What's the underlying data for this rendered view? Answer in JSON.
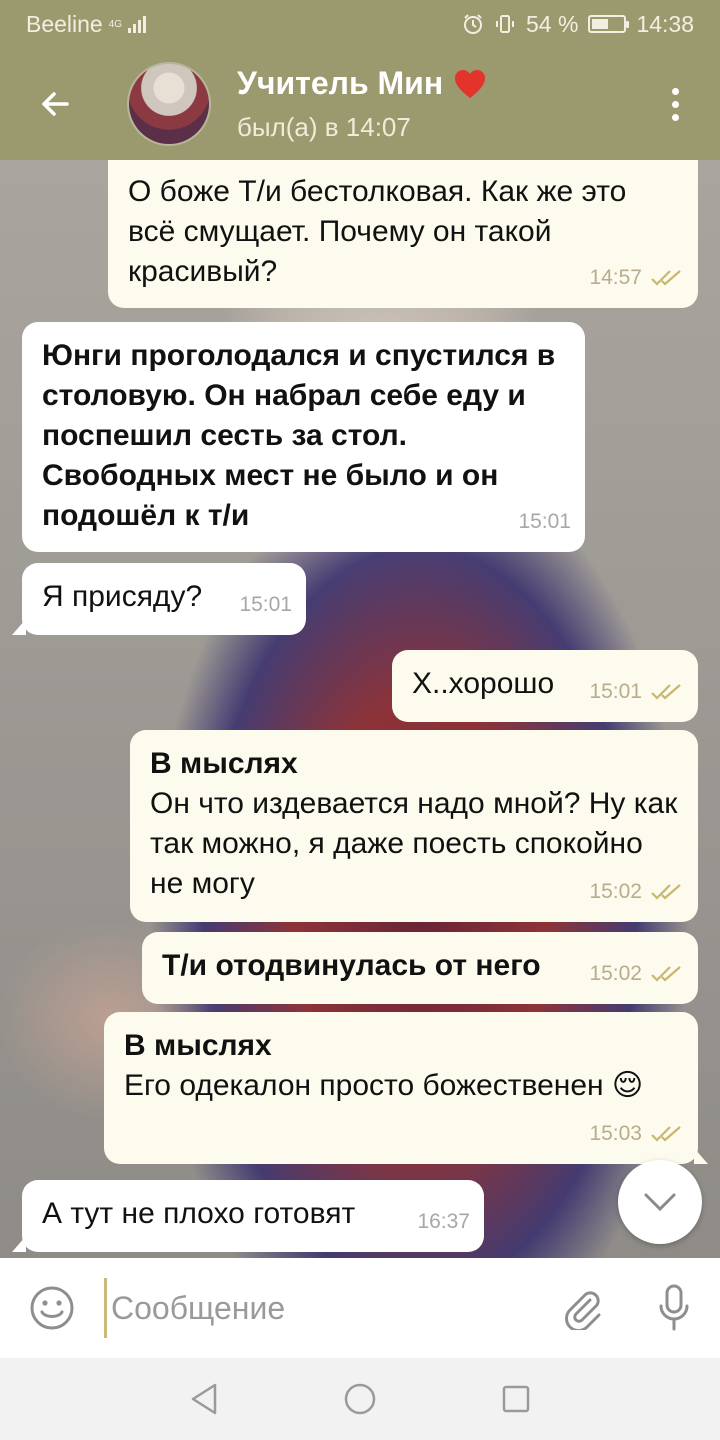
{
  "status_bar": {
    "carrier": "Beeline",
    "network": "4G",
    "battery_percent": "54 %",
    "battery_level": 0.54,
    "time": "14:38"
  },
  "header": {
    "back_icon": "arrow-left-icon",
    "name": "Учитель Мин",
    "name_emoji": "❤️",
    "status": "был(а) в 14:07",
    "menu_icon": "more-vertical-icon"
  },
  "messages": [
    {
      "side": "out",
      "title": "",
      "text": "О боже Т/и бестолковая. Как же это всё смущает. Почему он такой красивый?",
      "time": "14:57",
      "read": true,
      "bold": false
    },
    {
      "side": "in",
      "title": "",
      "text": "Юнги проголодался и спустился в столовую. Он набрал себе еду и поспешил сесть за стол. Свободных мест не было и он подошёл к т/и",
      "time": "15:01",
      "read": false,
      "bold": true
    },
    {
      "side": "in",
      "title": "",
      "text": "Я присяду?",
      "time": "15:01",
      "read": false,
      "bold": false
    },
    {
      "side": "out",
      "title": "",
      "text": "Х..хорошо",
      "time": "15:01",
      "read": true,
      "bold": false
    },
    {
      "side": "out",
      "title": "В мыслях",
      "text": "Он что издевается надо мной? Ну как так можно, я даже поесть спокойно не могу",
      "time": "15:02",
      "read": true,
      "bold": false
    },
    {
      "side": "out",
      "title": "",
      "text": "Т/и отодвинулась от него",
      "time": "15:02",
      "read": true,
      "bold": true
    },
    {
      "side": "out",
      "title": "В мыслях",
      "text": "Его одекалон просто божественен 😌",
      "time": "15:03",
      "read": true,
      "bold": false
    },
    {
      "side": "in",
      "title": "",
      "text": "А тут не плохо готовят",
      "time": "16:37",
      "read": false,
      "bold": false
    }
  ],
  "composer": {
    "placeholder": "Сообщение",
    "value": "",
    "emoji_icon": "smiley-icon",
    "attach_icon": "paperclip-icon",
    "mic_icon": "microphone-icon"
  },
  "navbar": {
    "back_icon": "triangle-back-icon",
    "home_icon": "circle-home-icon",
    "recents_icon": "square-recents-icon"
  },
  "colors": {
    "header_bg": "#9b9a6f",
    "bubble_out": "#fdfbee",
    "bubble_in": "#ffffff",
    "check_color": "#c8b76a"
  }
}
